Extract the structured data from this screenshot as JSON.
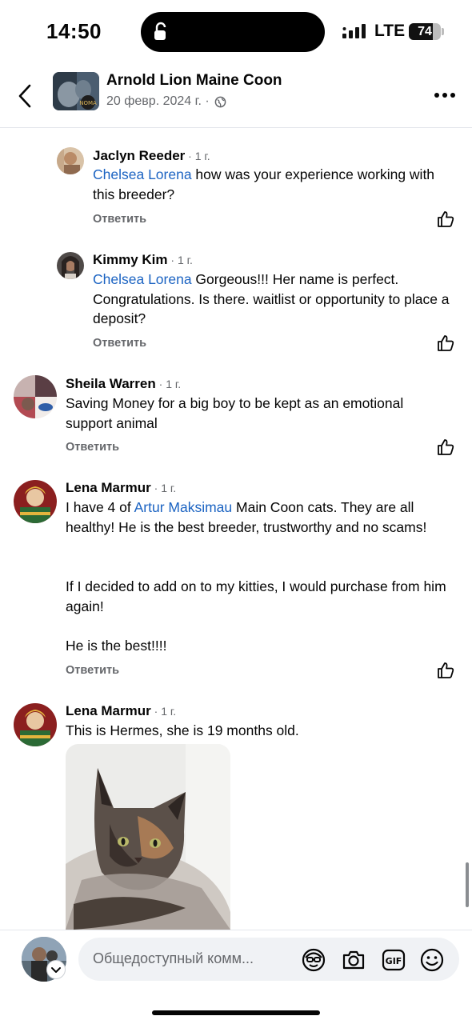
{
  "status_bar": {
    "time": "14:50",
    "network": "LTE",
    "battery": "74",
    "battery_level": 0.74
  },
  "header": {
    "page_name": "Arnold Lion Maine Coon",
    "date": "20 февр. 2024 г. ·",
    "back_icon": "chevron-left-icon",
    "more_icon": "more-dots-icon",
    "privacy_icon": "globe-icon"
  },
  "comments": [
    {
      "author": "Jaclyn Reeder",
      "time": " · 1 г.",
      "mention": "Chelsea Lorena",
      "text": " how was your experience working with this breeder?",
      "reply": "Ответить"
    },
    {
      "author": "Kimmy Kim",
      "time": " · 1 г.",
      "mention": "Chelsea Lorena",
      "text": " Gorgeous!!! Her name is perfect. Congratulations. Is there. waitlist or opportunity to place a deposit?",
      "reply": "Ответить"
    },
    {
      "author": "Sheila Warren",
      "time": " · 1 г.",
      "text": "Saving Money for a big boy to be kept as an emotional support animal",
      "reply": "Ответить"
    },
    {
      "author": "Lena Marmur",
      "time": " · 1 г.",
      "text_before": "I have 4 of ",
      "mention": "Artur Maksimau",
      "text_after": " Main Coon cats.  They are all healthy!  He is the best breeder, trustworthy and no scams!",
      "paragraph2": "If I decided to add on to my kitties, I would purchase from him again!",
      "paragraph3": "He is the best!!!!",
      "reply": "Ответить"
    },
    {
      "author": "Lena Marmur",
      "time": " · 1 г.",
      "text": "This is Hermes, she is 19 months old."
    }
  ],
  "composer": {
    "placeholder": "Общедоступный комм...",
    "icons": [
      "avatar-sticker-icon",
      "camera-icon",
      "gif-icon",
      "emoji-icon"
    ]
  }
}
